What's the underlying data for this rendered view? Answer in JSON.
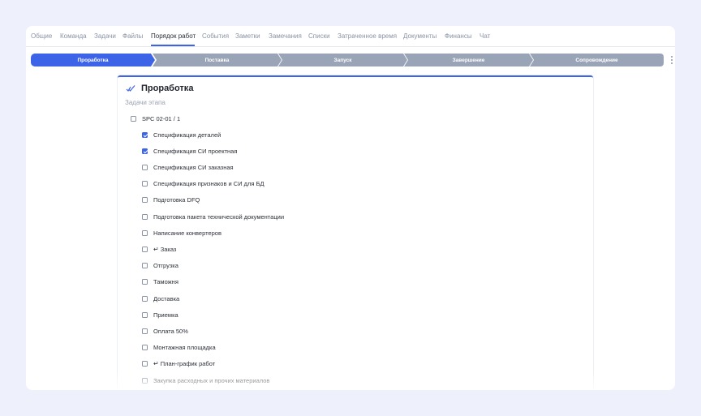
{
  "tabs": [
    {
      "label": "Общие"
    },
    {
      "label": "Команда"
    },
    {
      "label": "Задачи"
    },
    {
      "label": "Файлы"
    },
    {
      "label": "Порядок работ",
      "active": true
    },
    {
      "label": "События"
    },
    {
      "label": "Заметки"
    },
    {
      "label": "Замечания"
    },
    {
      "label": "Списки"
    },
    {
      "label": "Затраченное время"
    },
    {
      "label": "Документы"
    },
    {
      "label": "Финансы"
    },
    {
      "label": "Чат"
    }
  ],
  "stages": [
    {
      "label": "Проработка",
      "active": true
    },
    {
      "label": "Поставка"
    },
    {
      "label": "Запуск"
    },
    {
      "label": "Завершение"
    },
    {
      "label": "Сопровождение"
    }
  ],
  "card": {
    "title": "Проработка",
    "subtitle": "Задачи этапа",
    "parent": {
      "label": "SPC 02-01 / 1",
      "checked": false
    },
    "tasks": [
      {
        "label": "Спецификация деталей",
        "checked": true
      },
      {
        "label": "Спецификация СИ проектная",
        "checked": true
      },
      {
        "label": "Спецификация СИ заказная",
        "checked": false
      },
      {
        "label": "Спецификация признаков и СИ для БД",
        "checked": false
      },
      {
        "label": "Подготовка DFQ",
        "checked": false
      },
      {
        "label": "Подготовка пакета технической документации",
        "checked": false
      },
      {
        "label": "Написание конвертеров",
        "checked": false
      },
      {
        "label": "Заказ",
        "checked": false,
        "icon": "return-arrow-icon"
      },
      {
        "label": "Отгрузка",
        "checked": false
      },
      {
        "label": "Таможня",
        "checked": false
      },
      {
        "label": "Доставка",
        "checked": false
      },
      {
        "label": "Приемка",
        "checked": false
      },
      {
        "label": "Оплата 50%",
        "checked": false
      },
      {
        "label": "Монтажная площадка",
        "checked": false
      },
      {
        "label": "План-график работ",
        "checked": false,
        "icon": "return-arrow-icon"
      },
      {
        "label": "Закупка расходных и прочих материалов",
        "checked": false
      }
    ]
  },
  "colors": {
    "accent": "#3d64e6",
    "stage_inactive": "#99a5b7",
    "background": "#eef1fb"
  }
}
